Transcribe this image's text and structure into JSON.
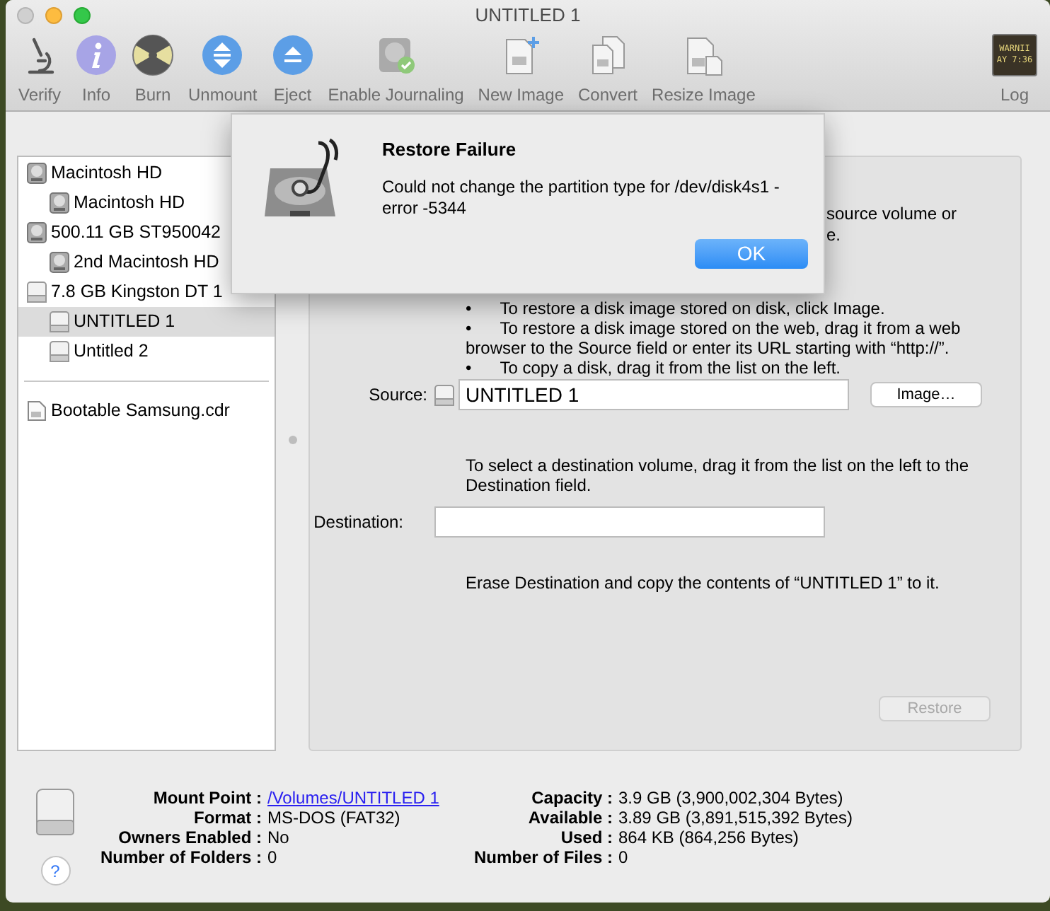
{
  "window": {
    "title": "UNTITLED 1"
  },
  "toolbar": [
    {
      "label": "Verify",
      "kind": "microscope"
    },
    {
      "label": "Info",
      "kind": "info"
    },
    {
      "label": "Burn",
      "kind": "burn"
    },
    {
      "label": "Unmount",
      "kind": "unmount"
    },
    {
      "label": "Eject",
      "kind": "eject"
    },
    {
      "label": "Enable Journaling",
      "kind": "journal"
    },
    {
      "label": "New Image",
      "kind": "newimage"
    },
    {
      "label": "Convert",
      "kind": "convert"
    },
    {
      "label": "Resize Image",
      "kind": "resize"
    }
  ],
  "log": {
    "label": "Log",
    "screen_lines": [
      "WARNII",
      "AY 7:36"
    ]
  },
  "sidebar": {
    "items": [
      {
        "label": "Macintosh HD",
        "kind": "hdd",
        "selected": false,
        "children": [
          {
            "label": "Macintosh HD",
            "kind": "hdd",
            "selected": false
          }
        ]
      },
      {
        "label": "500.11 GB ST950042",
        "kind": "hdd",
        "selected": false,
        "children": [
          {
            "label": "2nd Macintosh HD",
            "kind": "hdd",
            "selected": false
          }
        ]
      },
      {
        "label": "7.8 GB Kingston DT 1",
        "kind": "usb",
        "selected": false,
        "children": [
          {
            "label": "UNTITLED 1",
            "kind": "usb",
            "selected": true
          },
          {
            "label": "Untitled 2",
            "kind": "usb",
            "selected": false
          }
        ]
      }
    ],
    "images": [
      {
        "label": "Bootable Samsung.cdr",
        "kind": "image",
        "selected": false
      }
    ]
  },
  "restore": {
    "intro_fragments": [
      "source volume or",
      "e."
    ],
    "bullets": [
      {
        "marker": "•",
        "text": "To restore a disk image stored on disk, click Image."
      },
      {
        "marker": "•",
        "text": "To restore a disk image stored on the web, drag it from a web browser to the Source field or enter its URL starting with “http://”."
      },
      {
        "marker": "•",
        "text": "To copy a disk, drag it from the list on the left."
      }
    ],
    "source": {
      "label": "Source:",
      "value": "UNTITLED 1"
    },
    "image_button": "Image…",
    "destination_hint": "To select a destination volume, drag it from the list on the left to the Destination field.",
    "destination": {
      "label": "Destination:"
    },
    "erase_note": "Erase Destination and copy the contents of “UNTITLED 1” to it.",
    "restore_button": {
      "label": "Restore",
      "disabled": true
    }
  },
  "info": {
    "left": [
      {
        "label": "Mount Point :",
        "value": "/Volumes/UNTITLED 1",
        "kind": "link"
      },
      {
        "label": "Format :",
        "value": "MS-DOS (FAT32)",
        "kind": "text"
      },
      {
        "label": "Owners Enabled :",
        "value": "No",
        "kind": "text"
      },
      {
        "label": "Number of Folders :",
        "value": "0",
        "kind": "text"
      }
    ],
    "right": [
      {
        "label": "Capacity :",
        "value": "3.9 GB (3,900,002,304 Bytes)",
        "kind": "text"
      },
      {
        "label": "Available :",
        "value": "3.89 GB (3,891,515,392 Bytes)",
        "kind": "text"
      },
      {
        "label": "Used :",
        "value": "864 KB (864,256 Bytes)",
        "kind": "text"
      },
      {
        "label": "Number of Files :",
        "value": "0",
        "kind": "text"
      }
    ],
    "help": "?"
  },
  "dialog": {
    "title": "Restore Failure",
    "message": "Could not change the partition type for /dev/disk4s1 - error -5344",
    "button": "OK"
  }
}
